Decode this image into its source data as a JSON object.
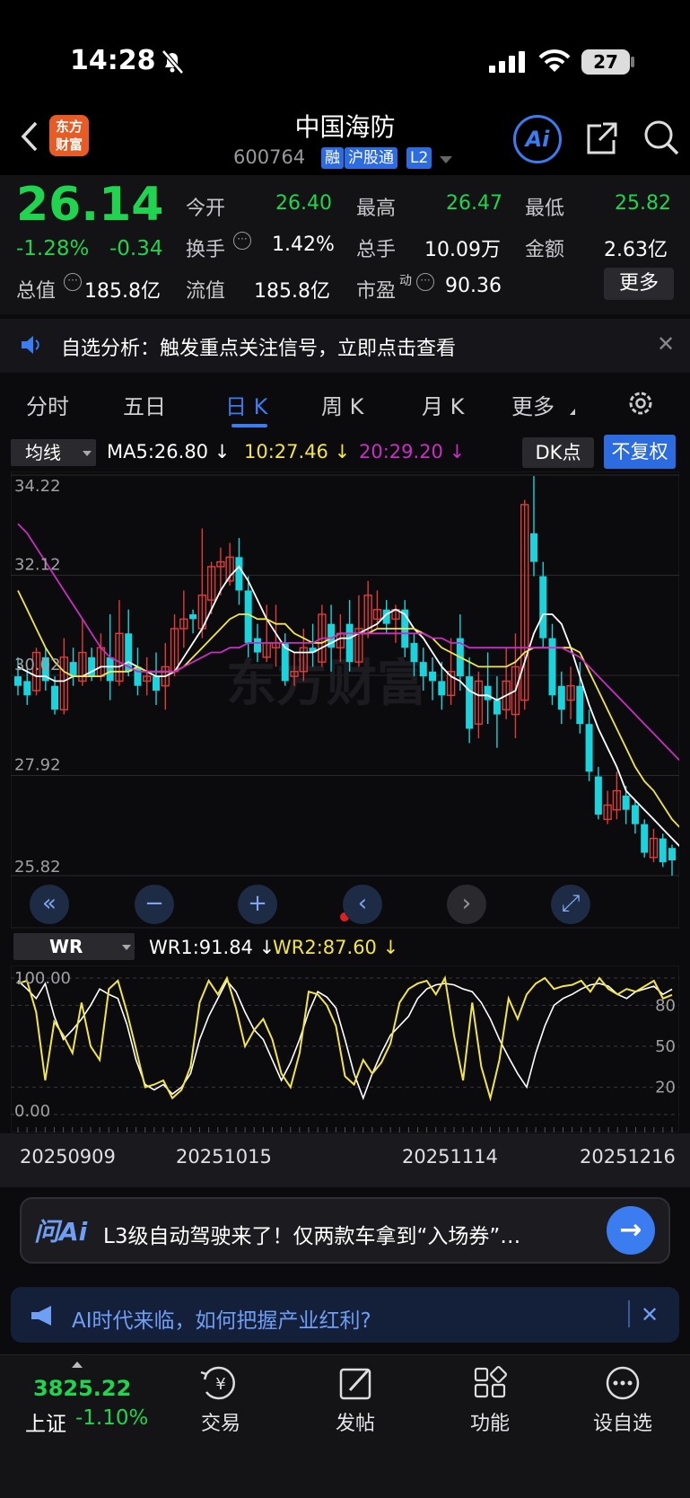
{
  "status": {
    "time": "14:28",
    "battery": "27"
  },
  "header": {
    "logo_line1": "东方",
    "logo_line2": "财富",
    "title": "中国海防",
    "code": "600764",
    "tags": [
      "融",
      "沪股通",
      "L2"
    ],
    "ai_label": "Ai"
  },
  "quote": {
    "price": "26.14",
    "change_pct": "-1.28%",
    "change": "-0.34",
    "open_label": "今开",
    "open": "26.40",
    "high_label": "最高",
    "high": "26.47",
    "low_label": "最低",
    "low": "25.82",
    "turnover_label": "换手",
    "turnover": "1.42%",
    "volume_label": "总手",
    "volume": "10.09万",
    "amount_label": "金额",
    "amount": "2.63亿",
    "mktcap_label": "总值",
    "mktcap": "185.8亿",
    "float_label": "流值",
    "float": "185.8亿",
    "pe_label": "市盈",
    "pe_sup": "动",
    "pe": "90.36",
    "more": "更多"
  },
  "notice": {
    "text": "自选分析：触发重点关注信号，立即点击查看"
  },
  "tabs": [
    "分时",
    "五日",
    "日 K",
    "周 K",
    "月 K",
    "更多"
  ],
  "active_tab": "日 K",
  "chart_bar": {
    "ma_select": "均线",
    "ma5": "MA5:26.80",
    "ma10": "10:27.46",
    "ma20": "20:29.20",
    "dk": "DK点",
    "fq": "不复权"
  },
  "colors": {
    "up": "#e23b3b",
    "down": "#19d4dc",
    "ma5": "#ffffff",
    "ma10": "#f2e54a",
    "ma20": "#c82fc3",
    "accent": "#3b7cf0",
    "green": "#1fd54f"
  },
  "wr_bar": {
    "select": "WR",
    "wr1": "WR1:91.84",
    "wr2": "WR2:87.60"
  },
  "dates": [
    "20250909",
    "20251015",
    "20251114",
    "20251216"
  ],
  "chart_data": [
    {
      "type": "candlestick",
      "title": "",
      "y_ticks": [
        "34.22",
        "32.12",
        "30.02",
        "27.92",
        "25.82"
      ],
      "ylim": [
        25.82,
        34.22
      ],
      "candles": [
        {
          "o": 30.0,
          "c": 29.8,
          "h": 30.4,
          "l": 29.6
        },
        {
          "o": 29.9,
          "c": 29.6,
          "h": 30.2,
          "l": 29.4
        },
        {
          "o": 29.7,
          "c": 30.5,
          "h": 30.6,
          "l": 29.6
        },
        {
          "o": 30.4,
          "c": 29.9,
          "h": 30.6,
          "l": 29.7
        },
        {
          "o": 29.8,
          "c": 29.3,
          "h": 30.0,
          "l": 29.2
        },
        {
          "o": 29.3,
          "c": 30.4,
          "h": 30.8,
          "l": 29.2
        },
        {
          "o": 30.3,
          "c": 30.0,
          "h": 30.6,
          "l": 29.8
        },
        {
          "o": 29.9,
          "c": 30.5,
          "h": 31.2,
          "l": 29.8
        },
        {
          "o": 30.4,
          "c": 30.0,
          "h": 30.6,
          "l": 29.9
        },
        {
          "o": 30.0,
          "c": 30.6,
          "h": 30.9,
          "l": 29.9
        },
        {
          "o": 30.4,
          "c": 29.9,
          "h": 31.3,
          "l": 29.5
        },
        {
          "o": 29.9,
          "c": 30.9,
          "h": 31.6,
          "l": 29.8
        },
        {
          "o": 30.9,
          "c": 30.1,
          "h": 31.4,
          "l": 30.0
        },
        {
          "o": 30.2,
          "c": 29.8,
          "h": 30.6,
          "l": 29.6
        },
        {
          "o": 29.9,
          "c": 30.0,
          "h": 30.4,
          "l": 29.6
        },
        {
          "o": 30.0,
          "c": 29.7,
          "h": 30.5,
          "l": 29.4
        },
        {
          "o": 29.8,
          "c": 30.2,
          "h": 30.7,
          "l": 29.3
        },
        {
          "o": 30.1,
          "c": 31.0,
          "h": 31.3,
          "l": 30.0
        },
        {
          "o": 31.0,
          "c": 31.2,
          "h": 31.8,
          "l": 30.6
        },
        {
          "o": 31.3,
          "c": 31.2,
          "h": 31.4,
          "l": 30.9
        },
        {
          "o": 31.0,
          "c": 31.7,
          "h": 33.1,
          "l": 30.8
        },
        {
          "o": 31.6,
          "c": 32.3,
          "h": 32.4,
          "l": 31.3
        },
        {
          "o": 32.3,
          "c": 32.4,
          "h": 32.7,
          "l": 31.7
        },
        {
          "o": 32.0,
          "c": 32.5,
          "h": 32.8,
          "l": 31.9
        },
        {
          "o": 32.5,
          "c": 31.8,
          "h": 32.9,
          "l": 31.5
        },
        {
          "o": 31.8,
          "c": 30.7,
          "h": 32.1,
          "l": 30.4
        },
        {
          "o": 30.8,
          "c": 30.5,
          "h": 31.1,
          "l": 30.3
        },
        {
          "o": 30.4,
          "c": 30.7,
          "h": 31.5,
          "l": 30.3
        },
        {
          "o": 30.6,
          "c": 30.7,
          "h": 31.5,
          "l": 30.2
        },
        {
          "o": 30.7,
          "c": 29.9,
          "h": 30.9,
          "l": 29.8
        },
        {
          "o": 30.0,
          "c": 30.1,
          "h": 30.5,
          "l": 29.8
        },
        {
          "o": 30.1,
          "c": 30.6,
          "h": 31.0,
          "l": 29.9
        },
        {
          "o": 30.6,
          "c": 30.5,
          "h": 31.1,
          "l": 30.2
        },
        {
          "o": 30.3,
          "c": 31.3,
          "h": 31.5,
          "l": 30.2
        },
        {
          "o": 31.1,
          "c": 30.6,
          "h": 31.5,
          "l": 30.1
        },
        {
          "o": 30.6,
          "c": 30.9,
          "h": 31.3,
          "l": 30.3
        },
        {
          "o": 31.1,
          "c": 30.3,
          "h": 31.6,
          "l": 30.1
        },
        {
          "o": 30.3,
          "c": 31.0,
          "h": 31.7,
          "l": 30.2
        },
        {
          "o": 30.9,
          "c": 31.7,
          "h": 32.0,
          "l": 30.8
        },
        {
          "o": 31.2,
          "c": 31.4,
          "h": 31.8,
          "l": 31.0
        },
        {
          "o": 31.4,
          "c": 31.1,
          "h": 31.6,
          "l": 30.9
        },
        {
          "o": 31.2,
          "c": 31.4,
          "h": 31.5,
          "l": 30.7
        },
        {
          "o": 31.4,
          "c": 30.6,
          "h": 31.6,
          "l": 30.4
        },
        {
          "o": 30.7,
          "c": 30.3,
          "h": 30.9,
          "l": 30.0
        },
        {
          "o": 30.3,
          "c": 30.0,
          "h": 30.6,
          "l": 29.7
        },
        {
          "o": 30.1,
          "c": 29.9,
          "h": 30.4,
          "l": 29.5
        },
        {
          "o": 29.9,
          "c": 29.6,
          "h": 30.3,
          "l": 29.3
        },
        {
          "o": 29.6,
          "c": 30.1,
          "h": 30.8,
          "l": 29.4
        },
        {
          "o": 30.8,
          "c": 30.0,
          "h": 31.3,
          "l": 29.7
        },
        {
          "o": 30.0,
          "c": 28.9,
          "h": 30.4,
          "l": 28.6
        },
        {
          "o": 29.0,
          "c": 29.9,
          "h": 30.1,
          "l": 28.7
        },
        {
          "o": 29.8,
          "c": 29.5,
          "h": 30.5,
          "l": 29.0
        },
        {
          "o": 29.5,
          "c": 29.2,
          "h": 30.0,
          "l": 28.5
        },
        {
          "o": 29.3,
          "c": 29.9,
          "h": 30.6,
          "l": 29.1
        },
        {
          "o": 29.2,
          "c": 30.2,
          "h": 30.9,
          "l": 28.7
        },
        {
          "o": 29.5,
          "c": 33.6,
          "h": 33.7,
          "l": 29.3
        },
        {
          "o": 33.0,
          "c": 32.4,
          "h": 34.2,
          "l": 32.1
        },
        {
          "o": 32.1,
          "c": 30.8,
          "h": 32.4,
          "l": 30.6
        },
        {
          "o": 30.8,
          "c": 29.6,
          "h": 31.1,
          "l": 29.4
        },
        {
          "o": 29.8,
          "c": 29.3,
          "h": 30.1,
          "l": 29.0
        },
        {
          "o": 29.5,
          "c": 29.8,
          "h": 30.2,
          "l": 29.1
        },
        {
          "o": 29.8,
          "c": 29.0,
          "h": 30.3,
          "l": 28.8
        },
        {
          "o": 29.0,
          "c": 28.0,
          "h": 29.3,
          "l": 27.8
        },
        {
          "o": 27.9,
          "c": 27.1,
          "h": 28.1,
          "l": 27.0
        },
        {
          "o": 27.0,
          "c": 27.3,
          "h": 27.6,
          "l": 26.9
        },
        {
          "o": 27.2,
          "c": 27.6,
          "h": 28.0,
          "l": 27.0
        },
        {
          "o": 27.5,
          "c": 27.2,
          "h": 27.7,
          "l": 26.9
        },
        {
          "o": 27.3,
          "c": 26.9,
          "h": 27.4,
          "l": 26.7
        },
        {
          "o": 26.9,
          "c": 26.3,
          "h": 27.0,
          "l": 26.2
        },
        {
          "o": 26.2,
          "c": 26.6,
          "h": 26.8,
          "l": 26.1
        },
        {
          "o": 26.6,
          "c": 26.1,
          "h": 26.7,
          "l": 26.0
        },
        {
          "o": 26.4,
          "c": 26.14,
          "h": 26.47,
          "l": 25.82
        }
      ],
      "ma_series": [
        {
          "name": "MA5",
          "values": [
            30.2,
            30.1,
            30.0,
            30.0,
            29.9,
            29.9,
            30.0,
            30.0,
            30.1,
            30.2,
            30.2,
            30.2,
            30.3,
            30.2,
            30.1,
            30.0,
            30.0,
            30.1,
            30.4,
            30.7,
            31.0,
            31.4,
            31.8,
            32.1,
            32.3,
            32.0,
            31.6,
            31.2,
            30.9,
            30.6,
            30.5,
            30.5,
            30.5,
            30.6,
            30.7,
            30.8,
            30.8,
            30.9,
            31.0,
            31.1,
            31.3,
            31.4,
            31.3,
            31.0,
            30.8,
            30.5,
            30.2,
            30.0,
            29.9,
            29.7,
            29.6,
            29.6,
            29.5,
            29.6,
            29.7,
            30.3,
            30.9,
            31.3,
            31.3,
            31.1,
            30.6,
            30.0,
            29.4,
            28.9,
            28.5,
            28.1,
            27.6,
            27.4,
            27.2,
            27.0,
            26.8,
            26.6,
            26.4
          ]
        },
        {
          "name": "MA10",
          "values": [
            31.8,
            31.4,
            31.0,
            30.6,
            30.3,
            30.1,
            30.0,
            30.0,
            30.0,
            30.0,
            30.1,
            30.1,
            30.1,
            30.2,
            30.1,
            30.1,
            30.1,
            30.1,
            30.2,
            30.4,
            30.6,
            30.8,
            31.0,
            31.2,
            31.3,
            31.3,
            31.2,
            31.2,
            31.1,
            31.1,
            30.9,
            30.8,
            30.7,
            30.7,
            30.8,
            30.9,
            30.9,
            30.9,
            30.9,
            31.0,
            31.0,
            31.0,
            31.0,
            31.0,
            30.9,
            30.8,
            30.6,
            30.5,
            30.4,
            30.3,
            30.2,
            30.2,
            30.2,
            30.2,
            30.3,
            30.5,
            30.6,
            30.6,
            30.6,
            30.6,
            30.6,
            30.5,
            30.1,
            29.7,
            29.3,
            28.9,
            28.5,
            28.1,
            27.8,
            27.6,
            27.3,
            27.0,
            26.8
          ]
        },
        {
          "name": "MA20",
          "values": [
            33.2,
            33.0,
            32.7,
            32.4,
            32.1,
            31.8,
            31.5,
            31.2,
            30.9,
            30.6,
            30.4,
            30.3,
            30.2,
            30.1,
            30.1,
            30.1,
            30.1,
            30.1,
            30.2,
            30.3,
            30.4,
            30.5,
            30.5,
            30.6,
            30.6,
            30.7,
            30.7,
            30.7,
            30.7,
            30.7,
            30.7,
            30.7,
            30.7,
            30.8,
            30.8,
            30.9,
            30.9,
            30.9,
            30.9,
            30.9,
            30.9,
            30.9,
            30.9,
            30.9,
            30.9,
            30.8,
            30.8,
            30.7,
            30.7,
            30.6,
            30.6,
            30.6,
            30.6,
            30.6,
            30.6,
            30.6,
            30.6,
            30.6,
            30.6,
            30.6,
            30.5,
            30.4,
            30.2,
            30.0,
            29.8,
            29.6,
            29.4,
            29.2,
            29.0,
            28.8,
            28.6,
            28.4,
            28.2
          ]
        }
      ]
    },
    {
      "type": "line",
      "title": "",
      "y_ticks": [
        "100.00",
        "80",
        "50",
        "20",
        "0.00"
      ],
      "ylim": [
        0,
        100
      ],
      "series": [
        {
          "name": "WR1",
          "values": [
            98,
            92,
            85,
            96,
            72,
            55,
            62,
            70,
            80,
            92,
            88,
            85,
            66,
            40,
            22,
            18,
            22,
            15,
            20,
            30,
            55,
            72,
            85,
            98,
            90,
            75,
            62,
            55,
            40,
            25,
            38,
            55,
            75,
            90,
            86,
            78,
            55,
            30,
            12,
            30,
            45,
            58,
            65,
            72,
            85,
            92,
            95,
            96,
            95,
            92,
            90,
            82,
            70,
            55,
            42,
            30,
            20,
            45,
            65,
            80,
            85,
            88,
            92,
            95,
            96,
            94,
            88,
            85,
            90,
            92,
            94,
            88,
            91.84
          ]
        },
        {
          "name": "WR2",
          "values": [
            96,
            98,
            75,
            25,
            68,
            58,
            45,
            82,
            50,
            40,
            92,
            98,
            75,
            48,
            20,
            22,
            25,
            12,
            18,
            35,
            82,
            98,
            88,
            100,
            78,
            50,
            62,
            70,
            55,
            30,
            20,
            45,
            90,
            88,
            80,
            65,
            28,
            22,
            40,
            30,
            38,
            52,
            82,
            92,
            96,
            98,
            88,
            100,
            58,
            25,
            82,
            35,
            12,
            40,
            85,
            70,
            88,
            96,
            100,
            92,
            94,
            95,
            98,
            90,
            100,
            92,
            88,
            92,
            90,
            94,
            98,
            85,
            87.6
          ]
        }
      ]
    }
  ],
  "ask": {
    "logo": "问Ai",
    "text": "L3级自动驾驶来了！仅两款车拿到“入场券”…"
  },
  "banner": {
    "text": "AI时代来临，如何把握产业红利?"
  },
  "nav": {
    "index_value": "3825.22",
    "index_name": "上证",
    "index_pct": "-1.10%",
    "items": [
      "交易",
      "发帖",
      "功能",
      "设自选"
    ]
  },
  "watermark": "东方财富"
}
